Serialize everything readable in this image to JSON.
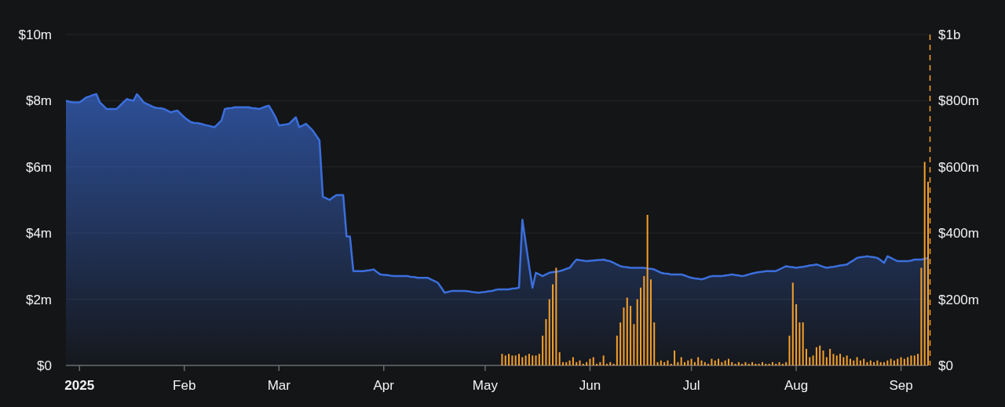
{
  "charts": [
    {
      "chart_data": {
        "type": "area",
        "grid": true,
        "ylim": [
          0,
          10
        ],
        "categories": [
          null,
          null,
          null,
          null,
          "2025",
          null,
          null,
          null,
          null,
          null,
          null,
          null,
          null,
          null,
          null,
          null,
          null,
          null,
          null,
          null,
          null,
          null,
          null,
          null,
          null,
          null,
          null,
          null,
          null,
          null,
          null,
          null,
          null,
          null,
          null,
          "Feb",
          null,
          null,
          null,
          null,
          null,
          null,
          null,
          null,
          null,
          null,
          null,
          null,
          null,
          null,
          null,
          null,
          null,
          null,
          null,
          null,
          null,
          null,
          null,
          null,
          null,
          null,
          null,
          "Mar",
          null,
          null,
          null,
          null,
          null,
          null,
          null,
          null,
          null,
          null,
          null,
          null,
          null,
          null,
          null,
          null,
          null,
          null,
          null,
          null,
          null,
          null,
          null,
          null,
          null,
          null,
          null,
          null,
          null,
          null,
          "Apr",
          null,
          null,
          null,
          null,
          null,
          null,
          null,
          null,
          null,
          null,
          null,
          null,
          null,
          null,
          null,
          null,
          null,
          null,
          null,
          null,
          null,
          null,
          null,
          null,
          null,
          null,
          null,
          null,
          null,
          "May",
          null,
          null,
          null,
          null,
          null,
          null,
          null,
          null,
          null,
          null,
          null,
          null,
          null,
          null,
          null,
          null,
          null,
          null,
          null,
          null,
          null,
          null,
          null,
          null,
          null,
          null,
          null,
          null,
          null,
          null,
          "Jun",
          null,
          null,
          null,
          null,
          null,
          null,
          null,
          null,
          null,
          null,
          null,
          null,
          null,
          null,
          null,
          null,
          null,
          null,
          null,
          null,
          null,
          null,
          null,
          null,
          null,
          null,
          null,
          null,
          null,
          "Jul",
          null,
          null,
          null,
          null,
          null,
          null,
          null,
          null,
          null,
          null,
          null,
          null,
          null,
          null,
          null,
          null,
          null,
          null,
          null,
          null,
          null,
          null,
          null,
          null,
          null,
          null,
          null,
          null,
          null,
          null,
          "Aug",
          null,
          null,
          null,
          null,
          null,
          null,
          null,
          null,
          null,
          null,
          null,
          null,
          null,
          null,
          null,
          null,
          null,
          null,
          null,
          null,
          null,
          null,
          null,
          null,
          null,
          null,
          null,
          null,
          null,
          null,
          "Sep",
          null,
          null,
          null,
          null,
          null,
          null,
          null,
          null
        ],
        "yticks": [
          {
            "value": 0,
            "label": "$0"
          },
          {
            "value": 2,
            "label": "$2m"
          },
          {
            "value": 4,
            "label": "$4m"
          },
          {
            "value": 6,
            "label": "$6m"
          },
          {
            "value": 8,
            "label": "$8m"
          },
          {
            "value": 10,
            "label": "$10m"
          }
        ],
        "series": [
          {
            "color": "#3b6fdc",
            "values": [
              8.0,
              7.97,
              7.95,
              7.95,
              7.95,
              8.02,
              8.1,
              8.13,
              8.17,
              8.2,
              7.95,
              7.85,
              7.75,
              7.75,
              7.75,
              7.75,
              7.85,
              7.95,
              8.05,
              8.02,
              8.0,
              8.2,
              8.08,
              7.95,
              7.9,
              7.85,
              7.8,
              7.78,
              7.77,
              7.75,
              7.7,
              7.65,
              7.68,
              7.7,
              7.6,
              7.5,
              7.42,
              7.35,
              7.33,
              7.32,
              7.3,
              7.27,
              7.25,
              7.22,
              7.2,
              7.3,
              7.4,
              7.75,
              7.77,
              7.78,
              7.8,
              7.8,
              7.8,
              7.8,
              7.8,
              7.78,
              7.77,
              7.75,
              7.78,
              7.82,
              7.85,
              7.68,
              7.5,
              7.25,
              7.27,
              7.28,
              7.3,
              7.4,
              7.5,
              7.2,
              7.25,
              7.3,
              7.2,
              7.1,
              6.95,
              6.8,
              5.1,
              5.05,
              5.0,
              5.08,
              5.15,
              5.15,
              5.15,
              3.9,
              3.9,
              2.85,
              2.85,
              2.85,
              2.85,
              2.87,
              2.88,
              2.9,
              2.82,
              2.75,
              2.74,
              2.73,
              2.71,
              2.7,
              2.7,
              2.7,
              2.7,
              2.7,
              2.68,
              2.67,
              2.65,
              2.65,
              2.65,
              2.65,
              2.6,
              2.55,
              2.5,
              2.35,
              2.2,
              2.22,
              2.25,
              2.25,
              2.25,
              2.25,
              2.25,
              2.24,
              2.22,
              2.21,
              2.2,
              2.21,
              2.22,
              2.24,
              2.25,
              2.28,
              2.3,
              2.3,
              2.3,
              2.3,
              2.32,
              2.33,
              2.35,
              4.4,
              3.7,
              3.0,
              2.35,
              2.8,
              2.75,
              2.7,
              2.75,
              2.8,
              2.82,
              2.83,
              2.85,
              2.88,
              2.92,
              2.95,
              3.08,
              3.2,
              3.18,
              3.17,
              3.15,
              3.16,
              3.17,
              3.18,
              3.19,
              3.2,
              3.17,
              3.15,
              3.1,
              3.05,
              3.0,
              2.98,
              2.97,
              2.95,
              2.95,
              2.95,
              2.95,
              2.95,
              2.93,
              2.92,
              2.9,
              2.85,
              2.8,
              2.78,
              2.77,
              2.75,
              2.75,
              2.75,
              2.75,
              2.72,
              2.68,
              2.65,
              2.63,
              2.62,
              2.6,
              2.63,
              2.67,
              2.7,
              2.7,
              2.7,
              2.7,
              2.72,
              2.73,
              2.75,
              2.73,
              2.72,
              2.7,
              2.72,
              2.75,
              2.78,
              2.8,
              2.82,
              2.83,
              2.85,
              2.85,
              2.85,
              2.85,
              2.9,
              2.95,
              3.0,
              2.98,
              2.97,
              2.95,
              2.97,
              2.98,
              3.0,
              3.02,
              3.03,
              3.05,
              3.02,
              2.98,
              2.95,
              2.97,
              2.98,
              3.0,
              3.02,
              3.03,
              3.05,
              3.12,
              3.18,
              3.25,
              3.27,
              3.28,
              3.3,
              3.28,
              3.27,
              3.25,
              3.18,
              3.1,
              3.3,
              3.25,
              3.2,
              3.15,
              3.15,
              3.15,
              3.15,
              3.17,
              3.2,
              3.2,
              3.2,
              3.22,
              3.25
            ]
          }
        ]
      }
    },
    {
      "chart_data": {
        "type": "bar",
        "ylim": [
          0,
          1000000000
        ],
        "categories": [
          null,
          null,
          null,
          null,
          null,
          null,
          null,
          null,
          null,
          null,
          null,
          null,
          null,
          null,
          null,
          null,
          null,
          null,
          null,
          null,
          null,
          null,
          null,
          null,
          null,
          null,
          null,
          null,
          null,
          null,
          null,
          null,
          null,
          null,
          null,
          null,
          null,
          null,
          null,
          null,
          null,
          null,
          null,
          null,
          null,
          null,
          null,
          null,
          null,
          null,
          null,
          null,
          null,
          null,
          null,
          null,
          null,
          null,
          null,
          null,
          null,
          null,
          null,
          null,
          null,
          null,
          null,
          null,
          null,
          null,
          null,
          null,
          null,
          null,
          null,
          null,
          null,
          null,
          null,
          null,
          null,
          null,
          null,
          null,
          null,
          null,
          null,
          null,
          null,
          null,
          null,
          null,
          null,
          null,
          null,
          null,
          null,
          null,
          null,
          null,
          null,
          null,
          null,
          null,
          null,
          null,
          null,
          null,
          null,
          null,
          null,
          null,
          null,
          null,
          null,
          null,
          null,
          null,
          null,
          null,
          null,
          null,
          null,
          null,
          null,
          null,
          null,
          null,
          null,
          null,
          null,
          null,
          null,
          null,
          null,
          null,
          null,
          null,
          null,
          null,
          null,
          null,
          null,
          null,
          null,
          null,
          null,
          null,
          null,
          null,
          null,
          null,
          null,
          null,
          null,
          null,
          null,
          null,
          null,
          null,
          null,
          null,
          null,
          null,
          null,
          null,
          null,
          null,
          null,
          null,
          null,
          null,
          null,
          null,
          null,
          null,
          null,
          null,
          null,
          null,
          null,
          null,
          null,
          null,
          null,
          null,
          null,
          null,
          null,
          null,
          null,
          null,
          null,
          null,
          null,
          null,
          null,
          null,
          null,
          null,
          null,
          null,
          null,
          null,
          null,
          null,
          null,
          null,
          null,
          null,
          null,
          null,
          null,
          null,
          null,
          null,
          null,
          null,
          null,
          null,
          null,
          null,
          null,
          null,
          null,
          null,
          null,
          null,
          null,
          null,
          null,
          null,
          null,
          null,
          null,
          null,
          null,
          null,
          null,
          null,
          null,
          null,
          null,
          null,
          null,
          null,
          null,
          null,
          null,
          null,
          null,
          null,
          null,
          null,
          null,
          null
        ],
        "yticks": [
          {
            "value": 0,
            "label": "$0"
          },
          {
            "value": 200000000,
            "label": "$200m"
          },
          {
            "value": 400000000,
            "label": "$400m"
          },
          {
            "value": 600000000,
            "label": "$600m"
          },
          {
            "value": 800000000,
            "label": "$800m"
          },
          {
            "value": 1000000000,
            "label": "$1b"
          }
        ],
        "series": [
          {
            "color": "#f5a02a",
            "values": [
              null,
              null,
              null,
              null,
              null,
              null,
              null,
              null,
              null,
              null,
              null,
              null,
              null,
              null,
              null,
              null,
              null,
              null,
              null,
              null,
              null,
              null,
              null,
              null,
              null,
              null,
              null,
              null,
              null,
              null,
              null,
              null,
              null,
              null,
              null,
              null,
              null,
              null,
              null,
              null,
              null,
              null,
              null,
              null,
              null,
              null,
              null,
              null,
              null,
              null,
              null,
              null,
              null,
              null,
              null,
              null,
              null,
              null,
              null,
              null,
              null,
              null,
              null,
              null,
              null,
              null,
              null,
              null,
              null,
              null,
              null,
              null,
              null,
              null,
              null,
              null,
              null,
              null,
              null,
              null,
              null,
              null,
              null,
              null,
              null,
              null,
              null,
              null,
              null,
              null,
              null,
              null,
              null,
              null,
              null,
              null,
              null,
              null,
              null,
              null,
              null,
              null,
              null,
              null,
              null,
              null,
              null,
              null,
              null,
              null,
              null,
              null,
              null,
              null,
              null,
              null,
              null,
              null,
              null,
              null,
              null,
              null,
              null,
              null,
              null,
              null,
              null,
              null,
              null,
              35000000,
              30000000,
              35000000,
              30000000,
              30000000,
              35000000,
              25000000,
              30000000,
              35000000,
              30000000,
              30000000,
              35000000,
              90000000,
              140000000,
              200000000,
              245000000,
              295000000,
              40000000,
              10000000,
              10000000,
              15000000,
              25000000,
              10000000,
              15000000,
              5000000,
              10000000,
              20000000,
              25000000,
              5000000,
              10000000,
              30000000,
              5000000,
              10000000,
              5000000,
              90000000,
              130000000,
              175000000,
              205000000,
              180000000,
              125000000,
              200000000,
              235000000,
              270000000,
              455000000,
              260000000,
              130000000,
              10000000,
              15000000,
              10000000,
              15000000,
              5000000,
              45000000,
              10000000,
              25000000,
              10000000,
              15000000,
              20000000,
              10000000,
              25000000,
              15000000,
              10000000,
              5000000,
              20000000,
              15000000,
              20000000,
              10000000,
              15000000,
              20000000,
              10000000,
              5000000,
              10000000,
              5000000,
              10000000,
              5000000,
              10000000,
              5000000,
              5000000,
              10000000,
              5000000,
              5000000,
              10000000,
              5000000,
              10000000,
              5000000,
              10000000,
              90000000,
              250000000,
              185000000,
              130000000,
              130000000,
              50000000,
              25000000,
              30000000,
              55000000,
              60000000,
              45000000,
              25000000,
              50000000,
              35000000,
              30000000,
              35000000,
              25000000,
              30000000,
              20000000,
              15000000,
              25000000,
              15000000,
              20000000,
              10000000,
              15000000,
              10000000,
              15000000,
              10000000,
              10000000,
              15000000,
              20000000,
              15000000,
              20000000,
              25000000,
              20000000,
              25000000,
              30000000,
              30000000,
              35000000,
              295000000,
              615000000,
              555000000
            ]
          }
        ]
      }
    }
  ]
}
